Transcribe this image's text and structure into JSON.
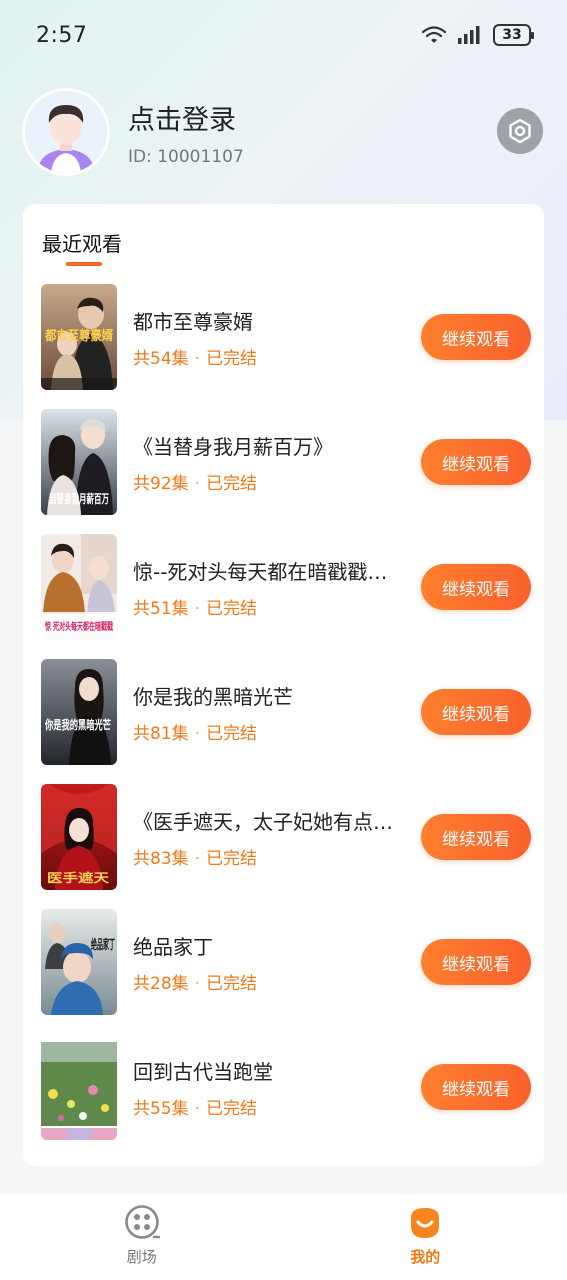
{
  "status_bar": {
    "time": "2:57",
    "battery": "33"
  },
  "profile": {
    "login_text": "点击登录",
    "user_id": "ID: 10001107"
  },
  "recent": {
    "title": "最近观看",
    "items": [
      {
        "title": "都市至尊豪婿",
        "episodes": "共54集",
        "status": "已完结",
        "button": "继续观看"
      },
      {
        "title": "《当替身我月薪百万》",
        "episodes": "共92集",
        "status": "已完结",
        "button": "继续观看"
      },
      {
        "title": "惊--死对头每天都在暗戳戳…",
        "episodes": "共51集",
        "status": "已完结",
        "button": "继续观看"
      },
      {
        "title": "你是我的黑暗光芒",
        "episodes": "共81集",
        "status": "已完结",
        "button": "继续观看"
      },
      {
        "title": "《医手遮天，太子妃她有点…",
        "episodes": "共83集",
        "status": "已完结",
        "button": "继续观看"
      },
      {
        "title": "绝品家丁",
        "episodes": "共28集",
        "status": "已完结",
        "button": "继续观看"
      },
      {
        "title": "回到古代当跑堂",
        "episodes": "共55集",
        "status": "已完结",
        "button": "继续观看"
      }
    ],
    "poster_labels": [
      "都市至尊豪婿",
      "当替身我月薪百万",
      "惊 死对头每天都在暗戳戳",
      "你是我的黑暗光芒",
      "医手遮天",
      "绝品家丁",
      ""
    ]
  },
  "bottom_nav": {
    "items": [
      {
        "label": "剧场",
        "icon": "film-reel-icon",
        "active": false
      },
      {
        "label": "我的",
        "icon": "smile-face-icon",
        "active": true
      }
    ]
  },
  "colors": {
    "accent": "#f07a18",
    "button_start": "#ff7f2f",
    "button_end": "#f9612c"
  }
}
